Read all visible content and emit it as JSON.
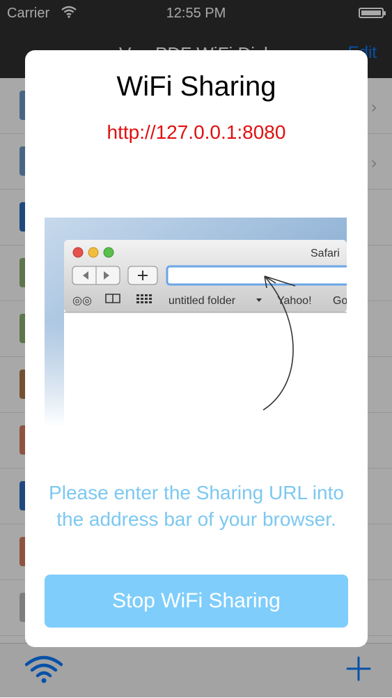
{
  "status_bar": {
    "carrier": "Carrier",
    "time": "12:55 PM"
  },
  "nav": {
    "title": "VeryPDF WiFi Disk",
    "edit_label": "Edit"
  },
  "modal": {
    "title": "WiFi Sharing",
    "url": "http://127.0.0.1:8080",
    "instructions": "Please enter the Sharing URL into the address bar of your browser.",
    "stop_button_label": "Stop WiFi Sharing",
    "illustration": {
      "window_title": "Safari",
      "bookmarks": [
        "untitled folder",
        "Yahoo!",
        "Go"
      ]
    }
  },
  "colors": {
    "url": "#e01010",
    "instructions": "#7cc8f0",
    "stop_button": "#7fcdfb",
    "accent": "#0a7cff"
  }
}
